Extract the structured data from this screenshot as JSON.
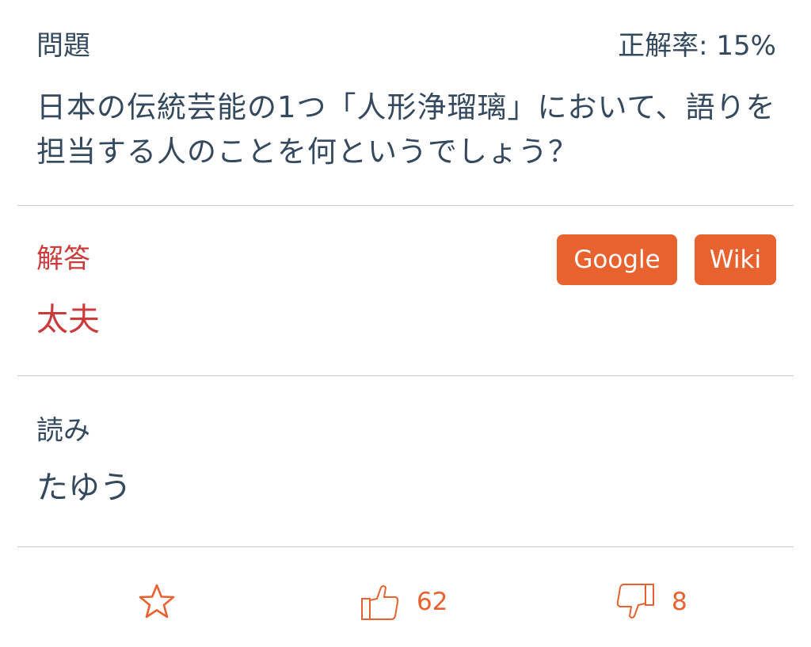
{
  "question": {
    "label": "問題",
    "rate_text": "正解率: 15%",
    "text": "日本の伝統芸能の1つ「人形浄瑠璃」において、語りを担当する人のことを何というでしょう？"
  },
  "answer": {
    "label": "解答",
    "text": "太夫",
    "google_label": "Google",
    "wiki_label": "Wiki"
  },
  "reading": {
    "label": "読み",
    "text": "たゆう"
  },
  "actions": {
    "favorite_icon": "star-icon",
    "like_icon": "thumbs-up-icon",
    "like_count": "62",
    "dislike_icon": "thumbs-down-icon",
    "dislike_count": "8"
  },
  "colors": {
    "accent": "#e8622f",
    "answer": "#cc3b3b",
    "text": "#34495e",
    "divider": "#c8c8c8"
  }
}
